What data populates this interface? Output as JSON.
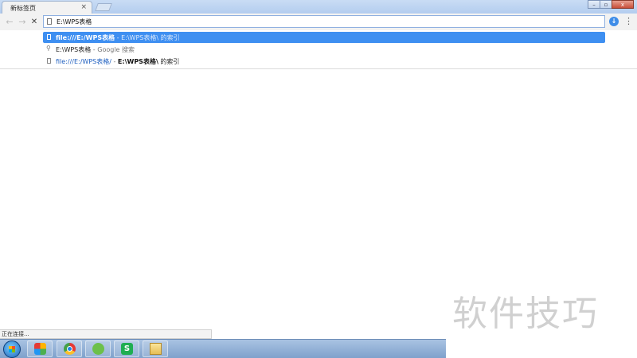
{
  "browser": {
    "tab": {
      "title": "新标签页",
      "close": "×"
    },
    "window_controls": [
      "–",
      "▫",
      "x"
    ],
    "omnibox": {
      "value": "E:\\WPS表格"
    }
  },
  "suggestions": [
    {
      "url": "file:///E:/WPS表格",
      "sep": " - ",
      "desc": "E:\\WPS表格\\ 的索引",
      "selected": true,
      "icon": "page-icon"
    },
    {
      "text": "E:\\WPS表格",
      "sep": " - ",
      "desc": "Google 搜索",
      "selected": false,
      "icon": "search-icon"
    },
    {
      "url": "file:///E:/WPS表格/",
      "sep": " - ",
      "bold": "E:\\WPS表格\\",
      "desc": " 的索引",
      "selected": false,
      "icon": "page-icon"
    }
  ],
  "status": "正在连接...",
  "watermark": "软件技巧",
  "taskbar": {
    "apps": [
      "launcher-icon",
      "chrome-icon",
      "wechat-icon",
      "wps-icon",
      "folder-icon"
    ],
    "wps_letter": "S"
  },
  "colors": {
    "accent": "#3e8ff1",
    "taskbar": "#a9c3e3"
  }
}
